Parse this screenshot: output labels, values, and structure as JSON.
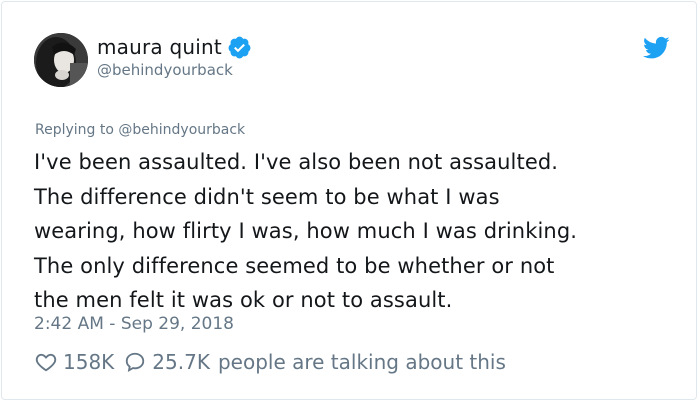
{
  "author": {
    "display_name": "maura quint",
    "handle": "@behindyourback",
    "verified": true
  },
  "icons": {
    "verified": "verified-badge-icon",
    "brand": "twitter-bird-icon",
    "like": "heart-icon",
    "reply": "speech-bubble-icon"
  },
  "reply_context": {
    "prefix": "Replying to",
    "handle": "@behindyourback"
  },
  "tweet": {
    "text": "I've been assaulted. I've also been not assaulted.\nThe difference didn't seem to be what I was\nwearing, how flirty I was, how much I was drinking.\nThe only difference seemed to be whether or not\nthe men felt it was ok or not to assault.",
    "timestamp": "2:42 AM - Sep 29, 2018"
  },
  "engagement": {
    "likes": "158K",
    "replies": "25.7K",
    "talking_label": "people are talking about this"
  },
  "colors": {
    "text": "#14171a",
    "muted": "#657786",
    "brand_blue": "#1da1f2",
    "border": "#e1e8ed"
  }
}
